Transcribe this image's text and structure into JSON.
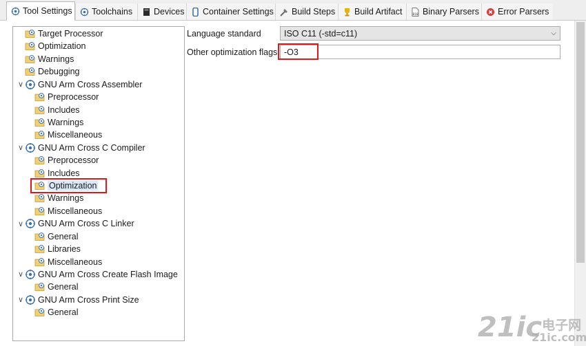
{
  "tabs": [
    {
      "label": "Tool Settings",
      "icon": "gear-tool-icon",
      "active": true
    },
    {
      "label": "Toolchains",
      "icon": "gear-tool-icon"
    },
    {
      "label": "Devices",
      "icon": "device-chip-icon"
    },
    {
      "label": "Container Settings",
      "icon": "container-icon"
    },
    {
      "label": "Build Steps",
      "icon": "build-steps-icon"
    },
    {
      "label": "Build Artifact",
      "icon": "trophy-icon"
    },
    {
      "label": "Binary Parsers",
      "icon": "binary-icon"
    },
    {
      "label": "Error Parsers",
      "icon": "error-icon"
    }
  ],
  "tree": {
    "items": [
      {
        "label": "Target Processor",
        "level": 0
      },
      {
        "label": "Optimization",
        "level": 0
      },
      {
        "label": "Warnings",
        "level": 0
      },
      {
        "label": "Debugging",
        "level": 0
      },
      {
        "label": "GNU Arm Cross Assembler",
        "level": 0,
        "group": true
      },
      {
        "label": "Preprocessor",
        "level": 1
      },
      {
        "label": "Includes",
        "level": 1
      },
      {
        "label": "Warnings",
        "level": 1
      },
      {
        "label": "Miscellaneous",
        "level": 1
      },
      {
        "label": "GNU Arm Cross C Compiler",
        "level": 0,
        "group": true
      },
      {
        "label": "Preprocessor",
        "level": 1
      },
      {
        "label": "Includes",
        "level": 1
      },
      {
        "label": "Optimization",
        "level": 1,
        "selected": true
      },
      {
        "label": "Warnings",
        "level": 1
      },
      {
        "label": "Miscellaneous",
        "level": 1
      },
      {
        "label": "GNU Arm Cross C Linker",
        "level": 0,
        "group": true
      },
      {
        "label": "General",
        "level": 1
      },
      {
        "label": "Libraries",
        "level": 1
      },
      {
        "label": "Miscellaneous",
        "level": 1
      },
      {
        "label": "GNU Arm Cross Create Flash Image",
        "level": 0,
        "group": true
      },
      {
        "label": "General",
        "level": 1
      },
      {
        "label": "GNU Arm Cross Print Size",
        "level": 0,
        "group": true
      },
      {
        "label": "General",
        "level": 1
      }
    ]
  },
  "settings": {
    "language_standard_label": "Language standard",
    "language_standard_value": "ISO C11 (-std=c11)",
    "other_flags_label": "Other optimization flags",
    "other_flags_value": "-O3"
  },
  "watermark": {
    "big": "21ic",
    "cn": "电子网",
    "sub": "21ic.com"
  },
  "colors": {
    "highlight": "#e0181c",
    "selection": "#dbe8f7"
  }
}
